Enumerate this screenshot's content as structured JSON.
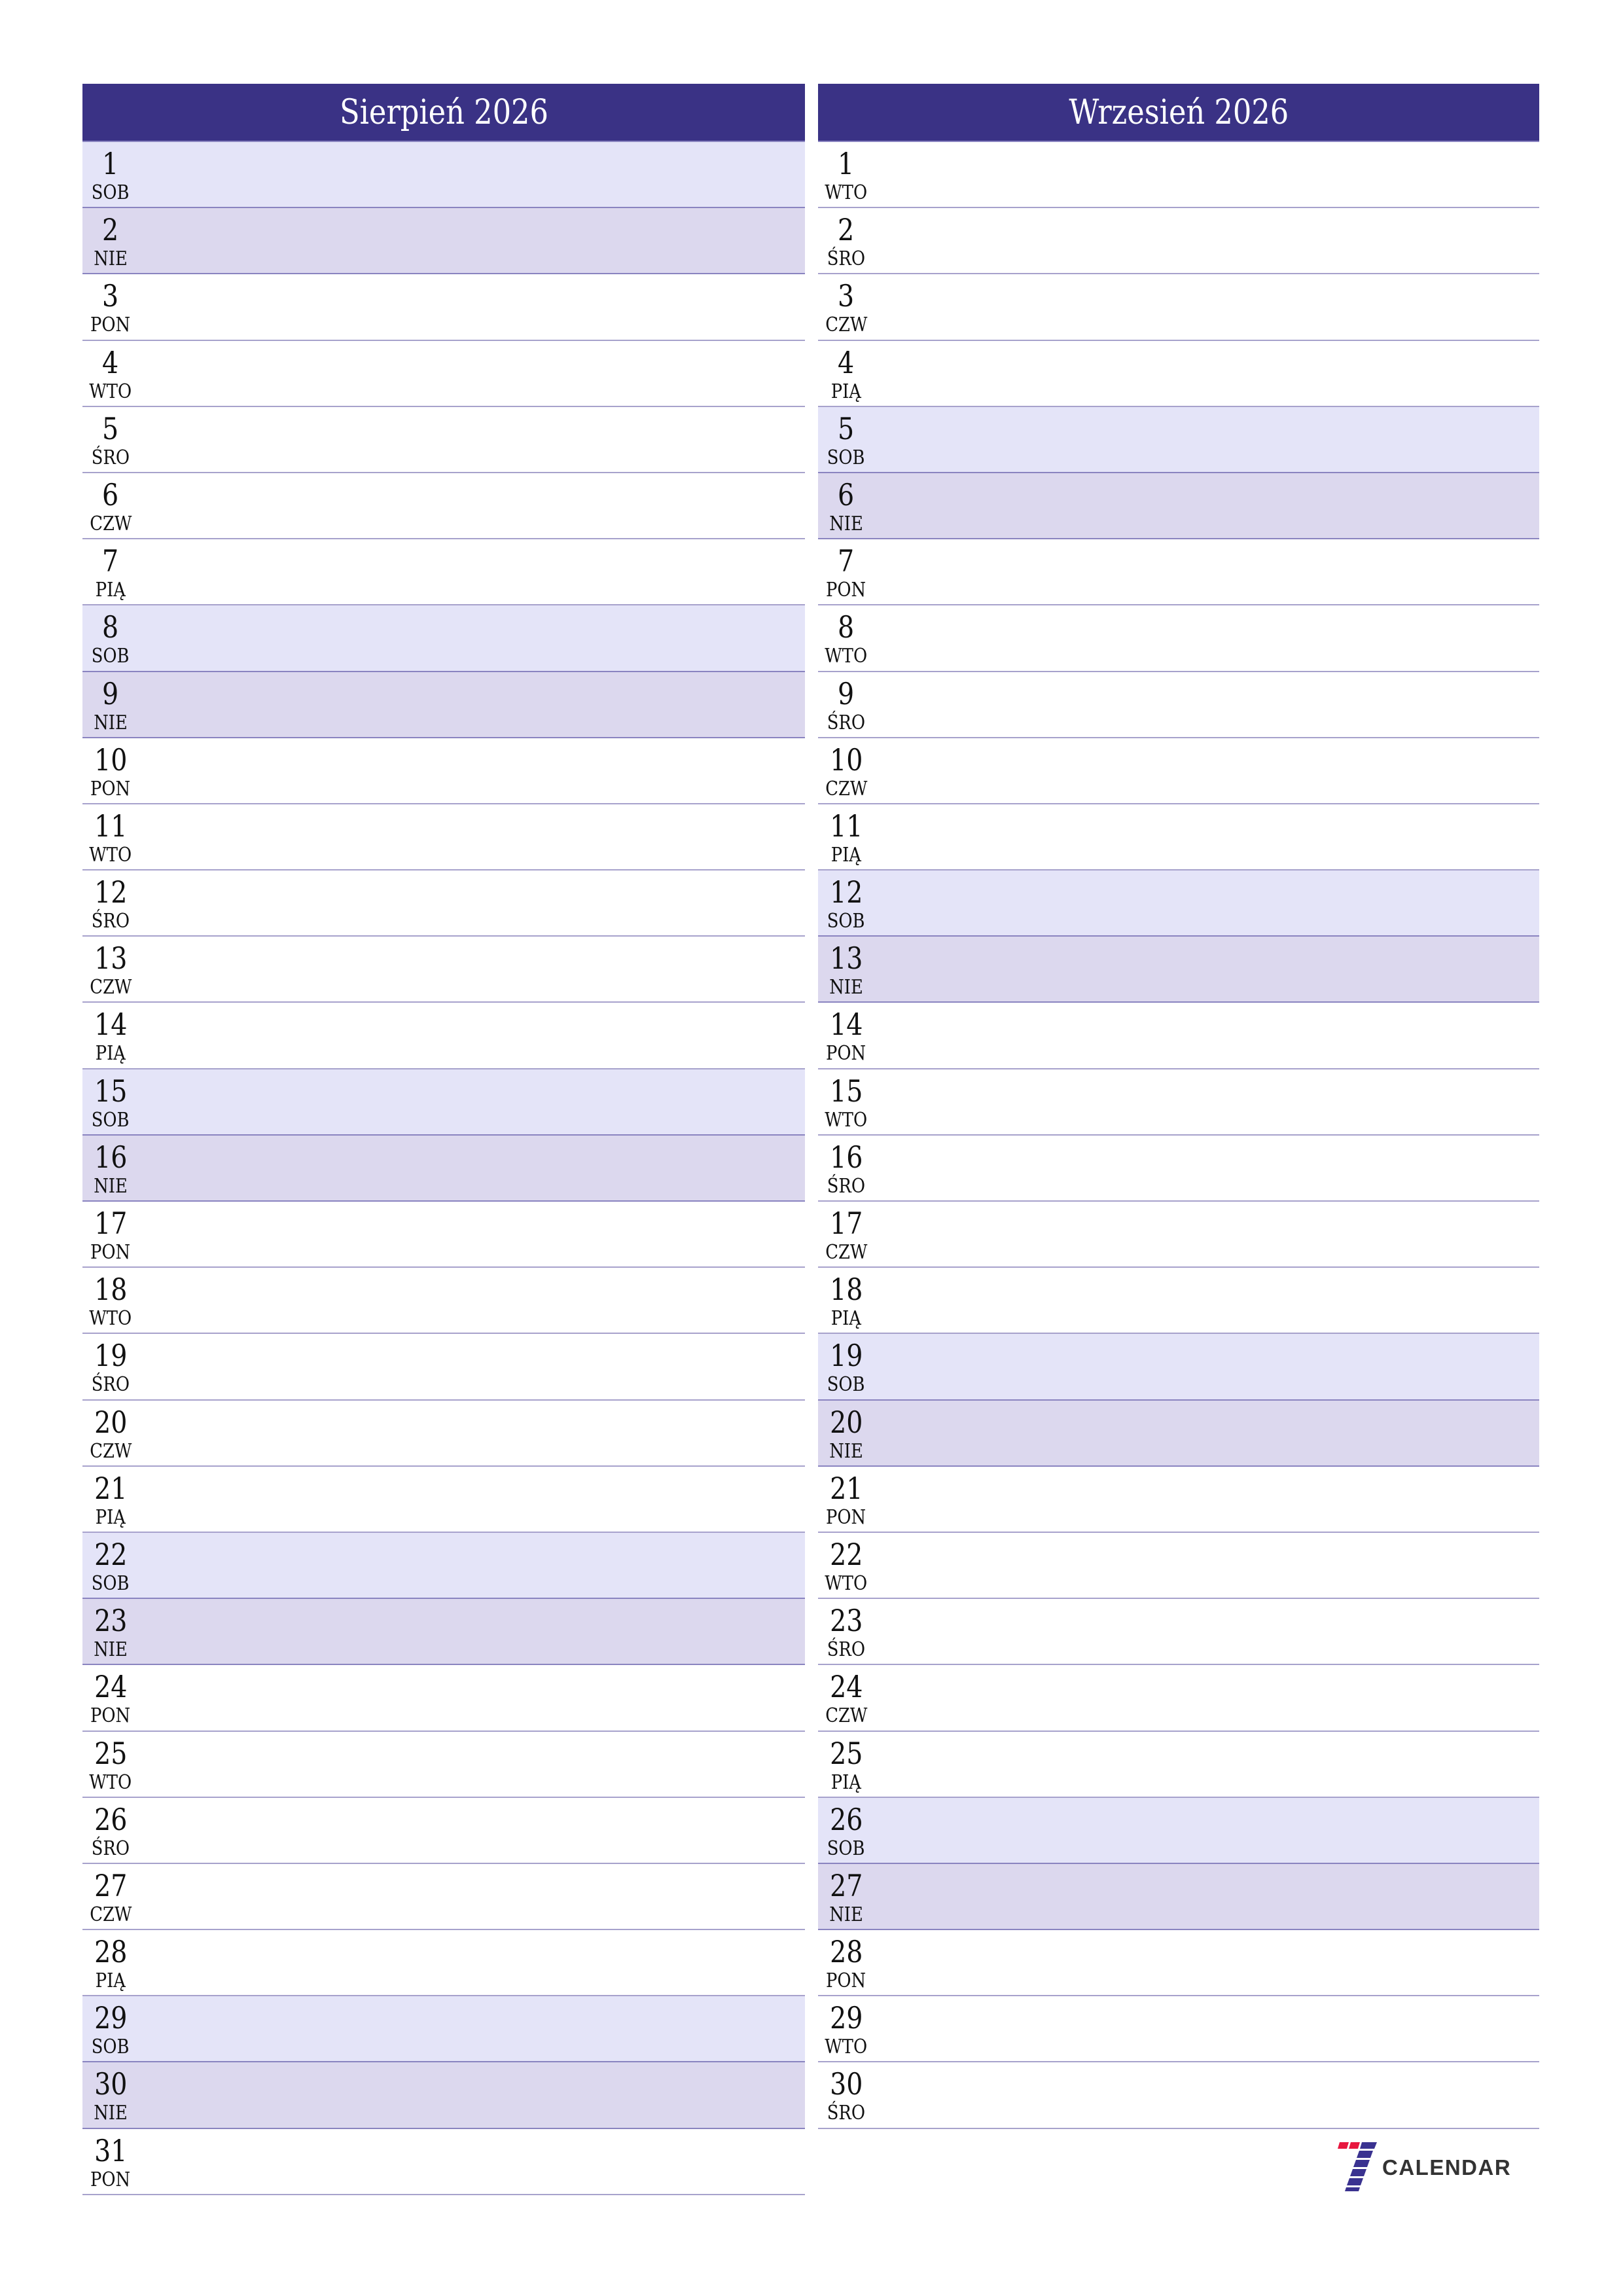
{
  "colors": {
    "header_bg": "#3a3285",
    "saturday_bg": "#e4e4f8",
    "sunday_bg": "#dcd8ee",
    "row_border": "#a7a2cc",
    "logo_red": "#e8173f",
    "logo_blue": "#3a3290",
    "logo_text": "#333333"
  },
  "months": [
    {
      "title": "Sierpień 2026",
      "days": [
        {
          "num": "1",
          "name": "SOB",
          "type": "sat"
        },
        {
          "num": "2",
          "name": "NIE",
          "type": "sun"
        },
        {
          "num": "3",
          "name": "PON",
          "type": "weekday"
        },
        {
          "num": "4",
          "name": "WTO",
          "type": "weekday"
        },
        {
          "num": "5",
          "name": "ŚRO",
          "type": "weekday"
        },
        {
          "num": "6",
          "name": "CZW",
          "type": "weekday"
        },
        {
          "num": "7",
          "name": "PIĄ",
          "type": "weekday"
        },
        {
          "num": "8",
          "name": "SOB",
          "type": "sat"
        },
        {
          "num": "9",
          "name": "NIE",
          "type": "sun"
        },
        {
          "num": "10",
          "name": "PON",
          "type": "weekday"
        },
        {
          "num": "11",
          "name": "WTO",
          "type": "weekday"
        },
        {
          "num": "12",
          "name": "ŚRO",
          "type": "weekday"
        },
        {
          "num": "13",
          "name": "CZW",
          "type": "weekday"
        },
        {
          "num": "14",
          "name": "PIĄ",
          "type": "weekday"
        },
        {
          "num": "15",
          "name": "SOB",
          "type": "sat"
        },
        {
          "num": "16",
          "name": "NIE",
          "type": "sun"
        },
        {
          "num": "17",
          "name": "PON",
          "type": "weekday"
        },
        {
          "num": "18",
          "name": "WTO",
          "type": "weekday"
        },
        {
          "num": "19",
          "name": "ŚRO",
          "type": "weekday"
        },
        {
          "num": "20",
          "name": "CZW",
          "type": "weekday"
        },
        {
          "num": "21",
          "name": "PIĄ",
          "type": "weekday"
        },
        {
          "num": "22",
          "name": "SOB",
          "type": "sat"
        },
        {
          "num": "23",
          "name": "NIE",
          "type": "sun"
        },
        {
          "num": "24",
          "name": "PON",
          "type": "weekday"
        },
        {
          "num": "25",
          "name": "WTO",
          "type": "weekday"
        },
        {
          "num": "26",
          "name": "ŚRO",
          "type": "weekday"
        },
        {
          "num": "27",
          "name": "CZW",
          "type": "weekday"
        },
        {
          "num": "28",
          "name": "PIĄ",
          "type": "weekday"
        },
        {
          "num": "29",
          "name": "SOB",
          "type": "sat"
        },
        {
          "num": "30",
          "name": "NIE",
          "type": "sun"
        },
        {
          "num": "31",
          "name": "PON",
          "type": "weekday"
        }
      ]
    },
    {
      "title": "Wrzesień 2026",
      "days": [
        {
          "num": "1",
          "name": "WTO",
          "type": "weekday"
        },
        {
          "num": "2",
          "name": "ŚRO",
          "type": "weekday"
        },
        {
          "num": "3",
          "name": "CZW",
          "type": "weekday"
        },
        {
          "num": "4",
          "name": "PIĄ",
          "type": "weekday"
        },
        {
          "num": "5",
          "name": "SOB",
          "type": "sat"
        },
        {
          "num": "6",
          "name": "NIE",
          "type": "sun"
        },
        {
          "num": "7",
          "name": "PON",
          "type": "weekday"
        },
        {
          "num": "8",
          "name": "WTO",
          "type": "weekday"
        },
        {
          "num": "9",
          "name": "ŚRO",
          "type": "weekday"
        },
        {
          "num": "10",
          "name": "CZW",
          "type": "weekday"
        },
        {
          "num": "11",
          "name": "PIĄ",
          "type": "weekday"
        },
        {
          "num": "12",
          "name": "SOB",
          "type": "sat"
        },
        {
          "num": "13",
          "name": "NIE",
          "type": "sun"
        },
        {
          "num": "14",
          "name": "PON",
          "type": "weekday"
        },
        {
          "num": "15",
          "name": "WTO",
          "type": "weekday"
        },
        {
          "num": "16",
          "name": "ŚRO",
          "type": "weekday"
        },
        {
          "num": "17",
          "name": "CZW",
          "type": "weekday"
        },
        {
          "num": "18",
          "name": "PIĄ",
          "type": "weekday"
        },
        {
          "num": "19",
          "name": "SOB",
          "type": "sat"
        },
        {
          "num": "20",
          "name": "NIE",
          "type": "sun"
        },
        {
          "num": "21",
          "name": "PON",
          "type": "weekday"
        },
        {
          "num": "22",
          "name": "WTO",
          "type": "weekday"
        },
        {
          "num": "23",
          "name": "ŚRO",
          "type": "weekday"
        },
        {
          "num": "24",
          "name": "CZW",
          "type": "weekday"
        },
        {
          "num": "25",
          "name": "PIĄ",
          "type": "weekday"
        },
        {
          "num": "26",
          "name": "SOB",
          "type": "sat"
        },
        {
          "num": "27",
          "name": "NIE",
          "type": "sun"
        },
        {
          "num": "28",
          "name": "PON",
          "type": "weekday"
        },
        {
          "num": "29",
          "name": "WTO",
          "type": "weekday"
        },
        {
          "num": "30",
          "name": "ŚRO",
          "type": "weekday"
        }
      ]
    }
  ],
  "logo": {
    "icon": "seven-logo-icon",
    "text": "CALENDAR"
  }
}
